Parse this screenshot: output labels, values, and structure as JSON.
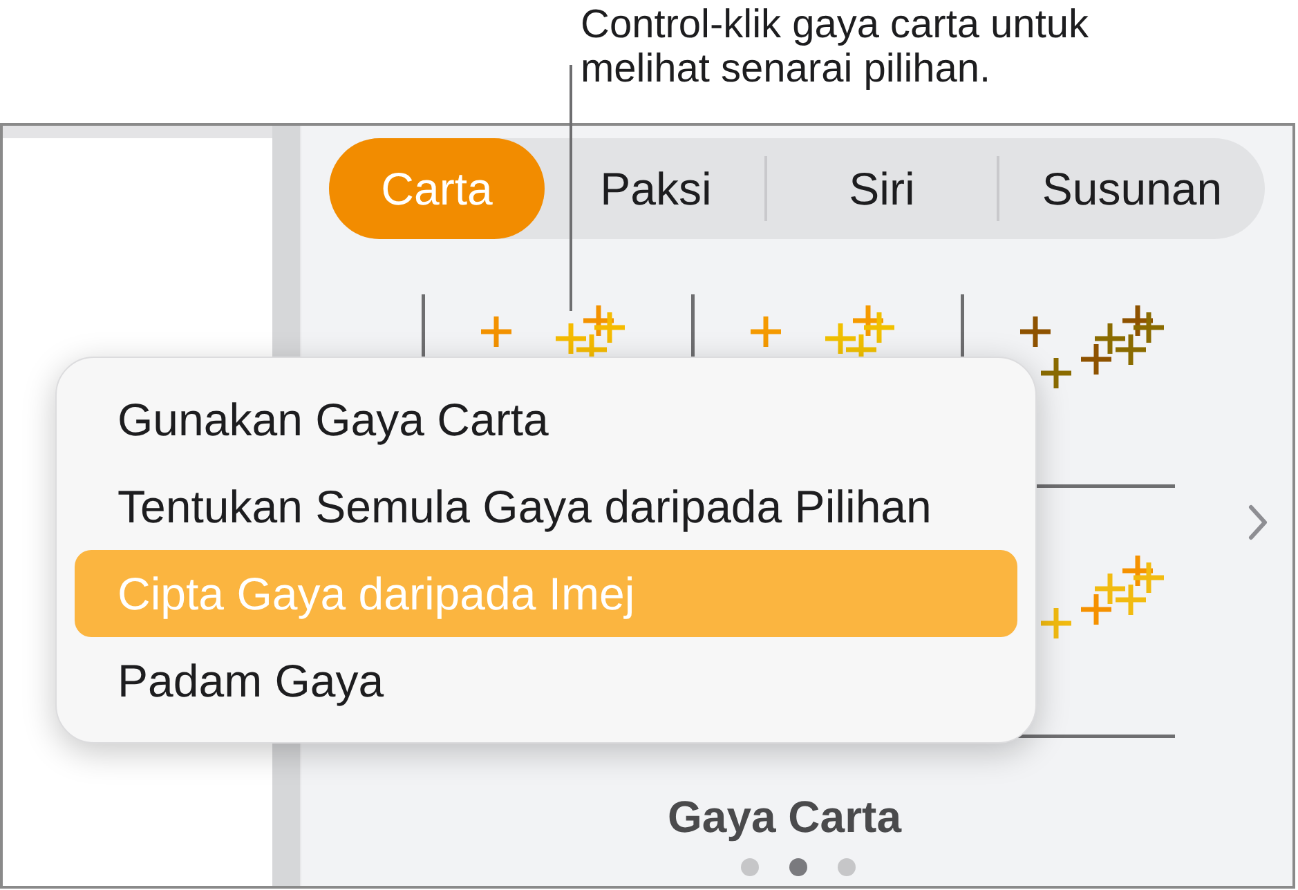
{
  "callout": {
    "text": "Control-klik gaya carta untuk melihat senarai pilihan."
  },
  "tabs": [
    {
      "label": "Carta",
      "selected": true
    },
    {
      "label": "Paksi",
      "selected": false
    },
    {
      "label": "Siri",
      "selected": false
    },
    {
      "label": "Susunan",
      "selected": false
    }
  ],
  "style_gallery": {
    "title": "Gaya Carta",
    "pages": [
      {
        "selected": false
      },
      {
        "selected": true
      },
      {
        "selected": false
      }
    ]
  },
  "context_menu": {
    "items": [
      {
        "label": "Gunakan Gaya Carta",
        "selected": false
      },
      {
        "label": "Tentukan Semula Gaya daripada Pilihan",
        "selected": false
      },
      {
        "label": "Cipta Gaya daripada Imej",
        "selected": true
      },
      {
        "label": "Padam Gaya",
        "selected": false
      }
    ]
  }
}
